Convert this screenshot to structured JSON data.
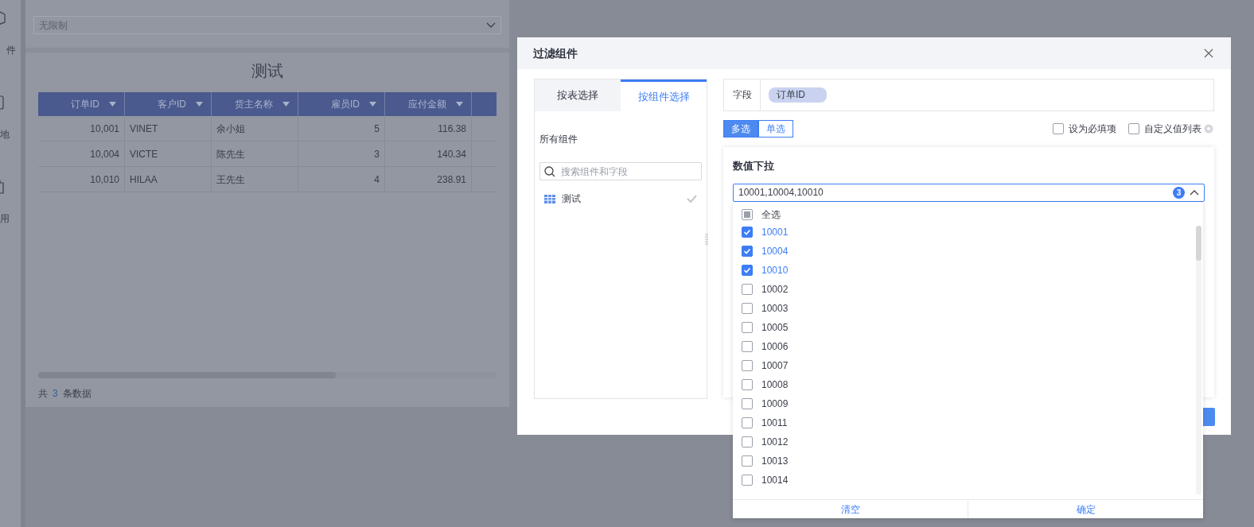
{
  "sidebar": {
    "items": [
      {
        "label": "件"
      },
      {
        "label": "地"
      },
      {
        "label": "用"
      }
    ]
  },
  "filter_select": {
    "value": "无限制"
  },
  "table_panel": {
    "title": "测试",
    "columns": [
      "订单ID",
      "客户ID",
      "货主名称",
      "雇员ID",
      "应付金额"
    ],
    "rows": [
      [
        "10,001",
        "VINET",
        "余小姐",
        "5",
        "116.38"
      ],
      [
        "10,004",
        "VICTE",
        "陈先生",
        "3",
        "140.34"
      ],
      [
        "10,010",
        "HILAA",
        "王先生",
        "4",
        "238.91"
      ]
    ],
    "footer": {
      "prefix": "共",
      "count": "3",
      "suffix": "条数据"
    }
  },
  "dialog": {
    "title": "过滤组件",
    "tabs": [
      {
        "label": "按表选择",
        "selected": false
      },
      {
        "label": "按组件选择",
        "selected": true
      }
    ],
    "section_label": "所有组件",
    "search": {
      "placeholder": "搜索组件和字段"
    },
    "components": [
      {
        "label": "测试",
        "checked": true
      }
    ],
    "field": {
      "label": "字段",
      "tag": "订单ID"
    },
    "modes": [
      {
        "label": "多选",
        "selected": true
      },
      {
        "label": "单选",
        "selected": false
      }
    ],
    "options": [
      {
        "label": "设为必填项",
        "checked": false
      },
      {
        "label": "自定义值列表",
        "checked": false
      }
    ],
    "card": {
      "title": "数值下拉",
      "value": "10001,10004,10010",
      "count": "3"
    },
    "dropdown": {
      "select_all": {
        "label": "全选",
        "indeterminate": true
      },
      "items": [
        {
          "label": "10001",
          "checked": true
        },
        {
          "label": "10004",
          "checked": true
        },
        {
          "label": "10010",
          "checked": true
        },
        {
          "label": "10002",
          "checked": false
        },
        {
          "label": "10003",
          "checked": false
        },
        {
          "label": "10005",
          "checked": false
        },
        {
          "label": "10006",
          "checked": false
        },
        {
          "label": "10007",
          "checked": false
        },
        {
          "label": "10008",
          "checked": false
        },
        {
          "label": "10009",
          "checked": false
        },
        {
          "label": "10011",
          "checked": false
        },
        {
          "label": "10012",
          "checked": false
        },
        {
          "label": "10013",
          "checked": false
        },
        {
          "label": "10014",
          "checked": false
        }
      ],
      "buttons": [
        "清空",
        "确定"
      ]
    }
  }
}
